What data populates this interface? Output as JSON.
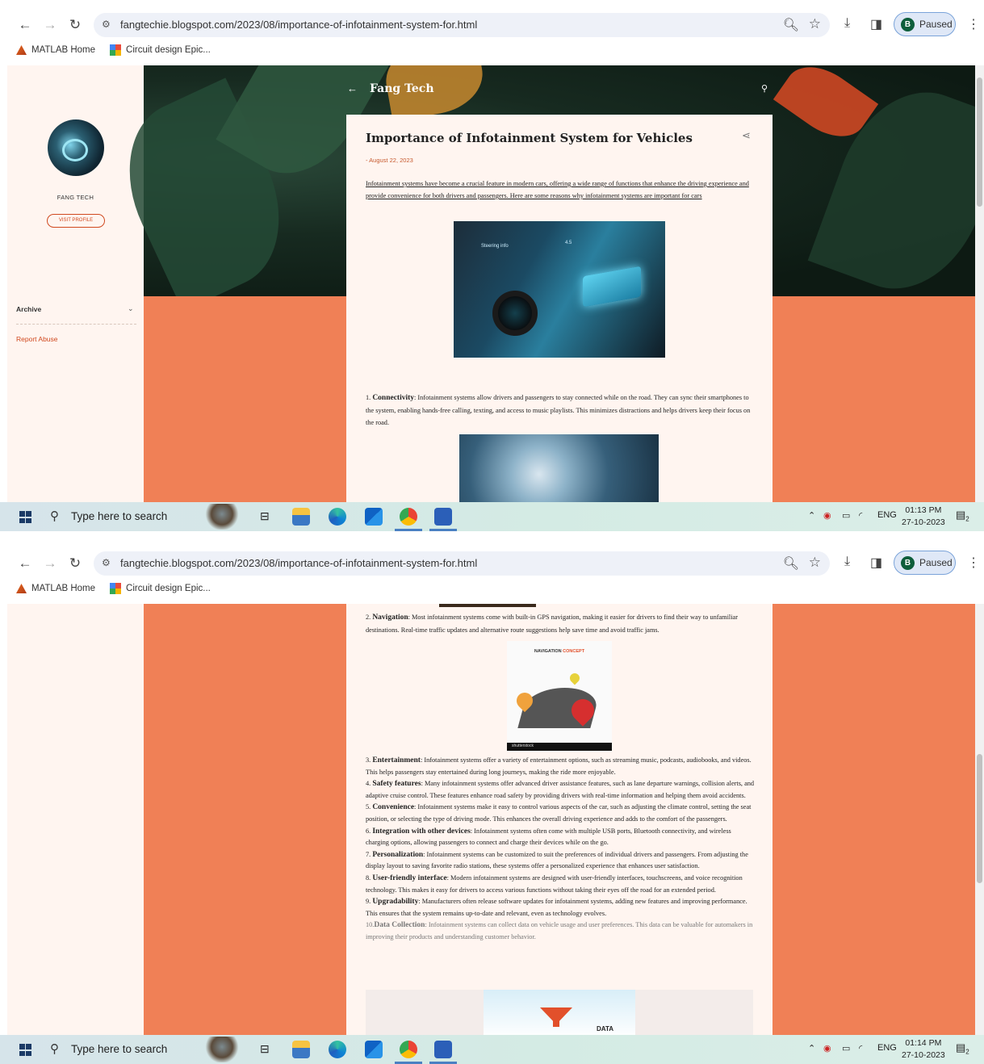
{
  "browser": {
    "url": "fangtechie.blogspot.com/2023/08/importance-of-infotainment-system-for.html",
    "profile_initial": "B",
    "profile_status": "Paused",
    "bookmarks": [
      {
        "label": "MATLAB Home",
        "icon": "matlab-icon"
      },
      {
        "label": "Circuit design Epic...",
        "icon": "grid-app-icon"
      }
    ]
  },
  "blog": {
    "name": "Fang Tech",
    "sidebar": {
      "profile_name": "FANG TECH",
      "visit_profile": "VISIT PROFILE",
      "archive": "Archive",
      "report_abuse": "Report Abuse"
    }
  },
  "post": {
    "title": "Importance of Infotainment System for Vehicles",
    "date": "- August 22, 2023",
    "intro": "Infotainment systems have become a crucial feature in modern cars, offering a wide range of functions that enhance the driving experience and provide convenience for both drivers and passengers. Here are some reasons why infotainment systems are important for cars",
    "points": [
      {
        "num": "1.",
        "title": "Connectivity",
        "body": ": Infotainment systems allow drivers and passengers to stay connected while on the road. They can sync their smartphones to the system, enabling hands-free calling, texting, and access to music playlists. This minimizes distractions and helps drivers keep their focus on the road."
      },
      {
        "num": "2.",
        "title": "Navigation",
        "body": ": Most infotainment systems come with built-in GPS navigation, making it easier for drivers to find their way to unfamiliar destinations. Real-time traffic updates and alternative route suggestions help save time and avoid traffic jams."
      },
      {
        "num": "3.",
        "title": "Entertainment",
        "body": ": Infotainment systems offer a variety of entertainment options, such as streaming music, podcasts, audiobooks, and videos. This helps passengers stay entertained during long journeys, making the ride more enjoyable."
      },
      {
        "num": "4.",
        "title": "Safety features",
        "body": ": Many infotainment systems offer advanced driver assistance features, such as lane departure warnings, collision alerts, and adaptive cruise control. These features enhance road safety by providing drivers with real-time information and helping them avoid accidents."
      },
      {
        "num": "5.",
        "title": "Convenience",
        "body": ": Infotainment systems make it easy to control various aspects of the car, such as adjusting the climate control, setting the seat position, or selecting the type of driving mode. This enhances the overall driving experience and adds to the comfort of the passengers."
      },
      {
        "num": "6.",
        "title": "Integration with other devices",
        "body": ": Infotainment systems often come with multiple USB ports, Bluetooth connectivity, and wireless charging options, allowing passengers to connect and charge their devices while on the go."
      },
      {
        "num": "7.",
        "title": "Personalization",
        "body": ": Infotainment systems can be customized to suit the preferences of individual drivers and passengers. From adjusting the display layout to saving favorite radio stations, these systems offer a personalized experience that enhances user satisfaction."
      },
      {
        "num": "8.",
        "title": "User-friendly interface",
        "body": ": Modern infotainment systems are designed with user-friendly interfaces, touchscreens, and voice recognition technology. This makes it easy for drivers to access various functions without taking their eyes off the road for an extended period."
      },
      {
        "num": "9.",
        "title": "Upgradability",
        "body": ": Manufacturers often release software updates for infotainment systems, adding new features and improving performance. This ensures that the system remains up-to-date and relevant, even as technology evolves."
      },
      {
        "num": "10.",
        "title": "Data Collection",
        "body": ": Infotainment systems can collect data on vehicle usage and user preferences. This data can be valuable for automakers in improving their products and understanding customer behavior."
      }
    ],
    "image_captions": {
      "car_hud_1": "Steering info",
      "car_hud_2": "4.5",
      "nav_image_title_1": "NAVIGATION",
      "nav_image_title_2": "CONCEPT",
      "nav_watermark": "shutterstock",
      "data_label": "DATA"
    }
  },
  "taskbar": {
    "search_placeholder": "Type here to search",
    "language": "ENG",
    "shots": [
      {
        "time": "01:13 PM",
        "date": "27-10-2023"
      },
      {
        "time": "01:14 PM",
        "date": "27-10-2023"
      }
    ],
    "notification_count": "2"
  }
}
